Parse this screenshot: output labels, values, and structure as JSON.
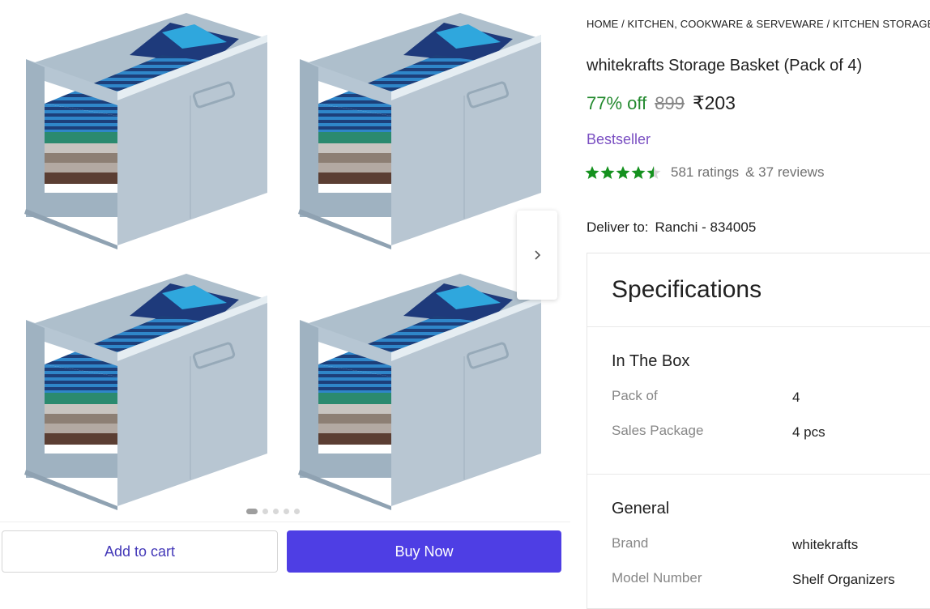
{
  "breadcrumb": "HOME / KITCHEN, COOKWARE & SERVEWARE / KITCHEN STORAGE & C",
  "product": {
    "title": "whitekrafts Storage Basket (Pack of 4)",
    "discount": "77% off",
    "mrp": "899",
    "price": "₹203",
    "badge": "Bestseller",
    "rating": 4.5,
    "ratings_count": "581 ratings",
    "reviews_count": "& 37 reviews"
  },
  "delivery": {
    "label": "Deliver to:",
    "location": "Ranchi - 834005"
  },
  "gallery": {
    "slides": 5,
    "active_slide": 1
  },
  "actions": {
    "add_to_cart": "Add to cart",
    "buy_now": "Buy Now"
  },
  "specifications": {
    "title": "Specifications",
    "sections": [
      {
        "name": "In The Box",
        "rows": [
          {
            "key": "Pack of",
            "value": "4"
          },
          {
            "key": "Sales Package",
            "value": "4 pcs"
          }
        ]
      },
      {
        "name": "General",
        "rows": [
          {
            "key": "Brand",
            "value": "whitekrafts"
          },
          {
            "key": "Model Number",
            "value": "Shelf Organizers"
          }
        ]
      }
    ]
  },
  "colors": {
    "buy_button": "#4e3ee4",
    "cart_text": "#4338b8",
    "discount": "#238a2f",
    "badge": "#7a4fc2",
    "star": "#14911e"
  }
}
